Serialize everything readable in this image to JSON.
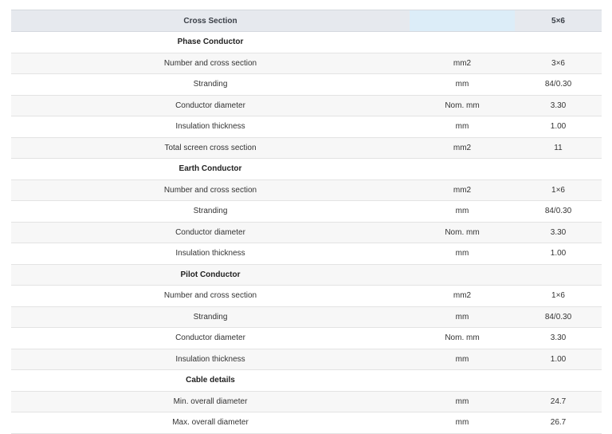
{
  "header": {
    "label": "Cross Section",
    "unit": "",
    "value": "5×6"
  },
  "rows": [
    {
      "type": "section",
      "label": "Phase Conductor"
    },
    {
      "type": "data",
      "label": "Number and cross section",
      "unit": "mm2",
      "value": "3×6"
    },
    {
      "type": "data",
      "label": "Stranding",
      "unit": "mm",
      "value": "84/0.30"
    },
    {
      "type": "data",
      "label": "Conductor diameter",
      "unit": "Nom. mm",
      "value": "3.30"
    },
    {
      "type": "data",
      "label": "Insulation thickness",
      "unit": "mm",
      "value": "1.00"
    },
    {
      "type": "data",
      "label": "Total screen cross section",
      "unit": "mm2",
      "value": "11"
    },
    {
      "type": "section",
      "label": "Earth Conductor"
    },
    {
      "type": "data",
      "label": "Number and cross section",
      "unit": "mm2",
      "value": "1×6"
    },
    {
      "type": "data",
      "label": "Stranding",
      "unit": "mm",
      "value": "84/0.30"
    },
    {
      "type": "data",
      "label": "Conductor diameter",
      "unit": "Nom. mm",
      "value": "3.30"
    },
    {
      "type": "data",
      "label": "Insulation thickness",
      "unit": "mm",
      "value": "1.00"
    },
    {
      "type": "section",
      "label": "Pilot Conductor"
    },
    {
      "type": "data",
      "label": "Number and cross section",
      "unit": "mm2",
      "value": "1×6"
    },
    {
      "type": "data",
      "label": "Stranding",
      "unit": "mm",
      "value": "84/0.30"
    },
    {
      "type": "data",
      "label": "Conductor diameter",
      "unit": "Nom. mm",
      "value": "3.30"
    },
    {
      "type": "data",
      "label": "Insulation thickness",
      "unit": "mm",
      "value": "1.00"
    },
    {
      "type": "section",
      "label": "Cable details"
    },
    {
      "type": "data",
      "label": "Min. overall diameter",
      "unit": "mm",
      "value": "24.7"
    },
    {
      "type": "data",
      "label": "Max. overall diameter",
      "unit": "mm",
      "value": "26.7"
    }
  ]
}
